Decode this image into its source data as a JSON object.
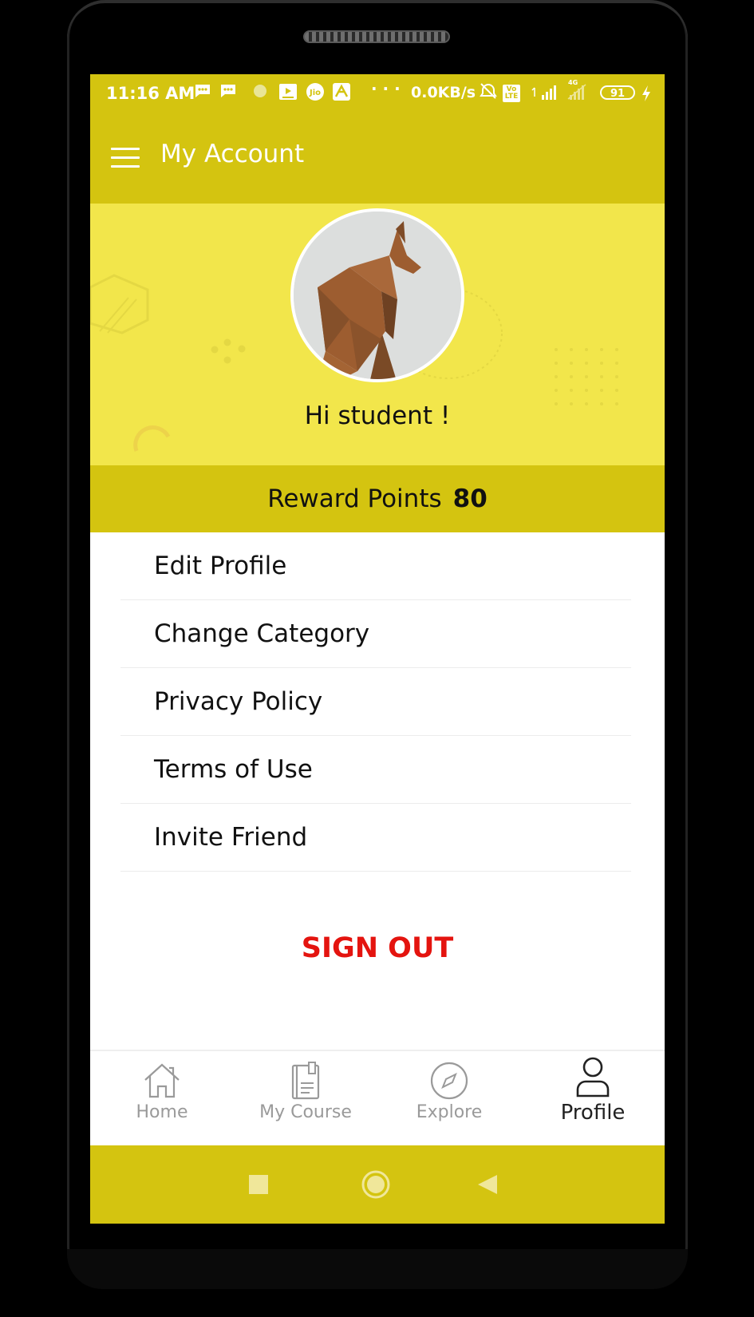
{
  "status_bar": {
    "time": "11:16 AM",
    "more": "· · ·",
    "speed": "0.0KB/s",
    "volte": "Vo LTE",
    "network": "4G",
    "battery": "91"
  },
  "app_bar": {
    "title": "My Account"
  },
  "profile": {
    "greeting": "Hi student !"
  },
  "reward": {
    "label": "Reward Points",
    "points": "80"
  },
  "menu": [
    {
      "label": "Edit Profile"
    },
    {
      "label": "Change Category"
    },
    {
      "label": "Privacy Policy"
    },
    {
      "label": "Terms of Use"
    },
    {
      "label": "Invite Friend"
    }
  ],
  "sign_out": {
    "label": "SIGN OUT"
  },
  "bottom_nav": [
    {
      "label": "Home",
      "icon": "home-icon"
    },
    {
      "label": "My Course",
      "icon": "book-icon"
    },
    {
      "label": "Explore",
      "icon": "compass-icon"
    },
    {
      "label": "Profile",
      "icon": "person-icon",
      "active": true
    }
  ],
  "colors": {
    "accent": "#d4c410",
    "header_bg": "#f2e64b",
    "sign_out": "#e4140f"
  }
}
